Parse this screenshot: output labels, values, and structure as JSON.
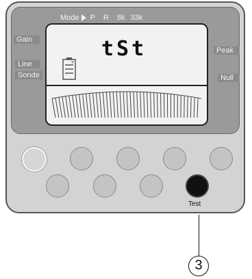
{
  "mode_bar": {
    "label": "Mode",
    "options": [
      "P",
      "R",
      "8k",
      "33k"
    ]
  },
  "left_labels": [
    "Gain",
    "Line",
    "Sonde"
  ],
  "right_labels": [
    "Peak",
    "Null"
  ],
  "lcd": {
    "text": "tSt",
    "battery_icon": "battery-icon"
  },
  "buttons": {
    "test_label": "Test"
  },
  "callout": {
    "number": "3"
  }
}
